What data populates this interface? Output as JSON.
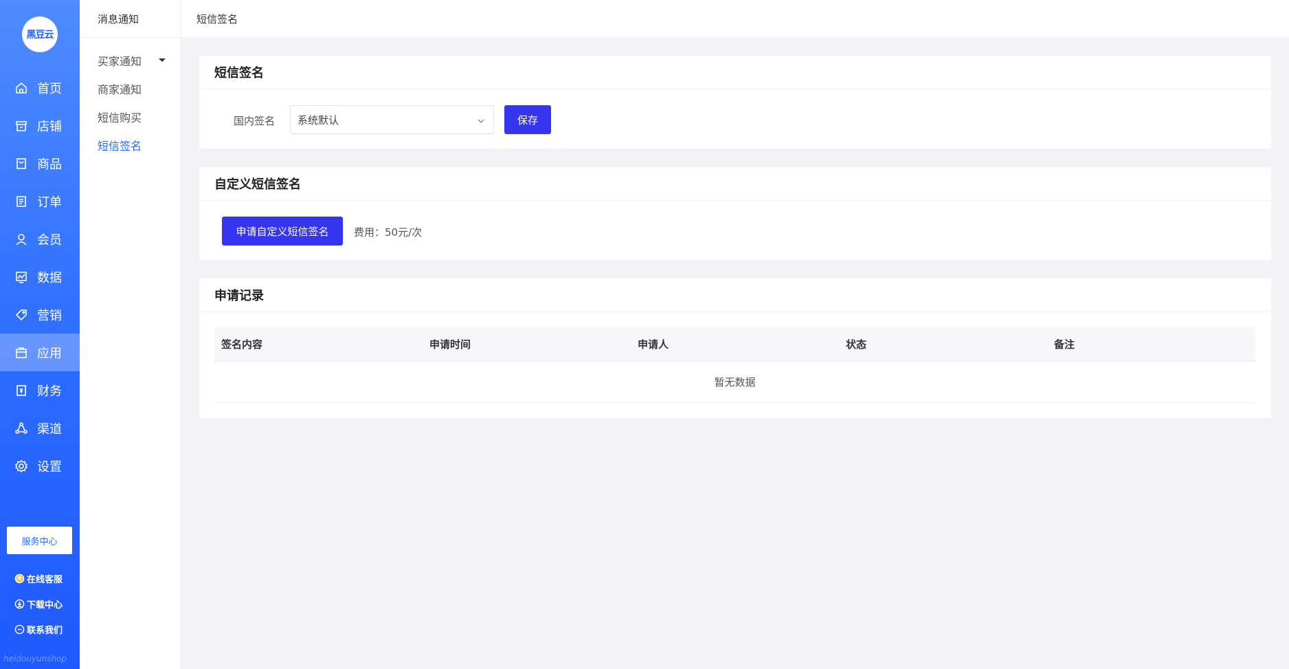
{
  "brand": {
    "logo_text": "黑豆云",
    "watermark": "heidouyunshop"
  },
  "nav": {
    "items": [
      {
        "label": "首页",
        "icon": "home-icon"
      },
      {
        "label": "店铺",
        "icon": "store-icon"
      },
      {
        "label": "商品",
        "icon": "goods-icon"
      },
      {
        "label": "订单",
        "icon": "order-icon"
      },
      {
        "label": "会员",
        "icon": "member-icon"
      },
      {
        "label": "数据",
        "icon": "data-icon"
      },
      {
        "label": "营销",
        "icon": "tag-icon"
      },
      {
        "label": "应用",
        "icon": "app-icon"
      },
      {
        "label": "财务",
        "icon": "finance-icon"
      },
      {
        "label": "渠道",
        "icon": "channel-icon"
      },
      {
        "label": "设置",
        "icon": "gear-icon"
      }
    ],
    "active": "应用"
  },
  "service": {
    "button_label": "服务中心",
    "links": [
      {
        "label": "在线客服",
        "icon": "support-avatar-icon"
      },
      {
        "label": "下载中心",
        "icon": "download-icon"
      },
      {
        "label": "联系我们",
        "icon": "contact-icon"
      }
    ]
  },
  "subside": {
    "title": "消息通知",
    "items": [
      {
        "label": "买家通知",
        "has_caret": true
      },
      {
        "label": "商家通知"
      },
      {
        "label": "短信购买"
      },
      {
        "label": "短信签名",
        "active": true
      }
    ]
  },
  "topbar": {
    "breadcrumb": "短信签名"
  },
  "signature": {
    "title": "短信签名",
    "domestic_label": "国内签名",
    "selected_value": "系统默认",
    "save_label": "保存"
  },
  "custom": {
    "title": "自定义短信签名",
    "apply_label": "申请自定义短信签名",
    "fee_text": "费用：50元/次"
  },
  "records": {
    "title": "申请记录",
    "columns": [
      "签名内容",
      "申请时间",
      "申请人",
      "状态",
      "备注"
    ],
    "empty_text": "暂无数据"
  },
  "colors": {
    "primary": "#3535ef",
    "accent_blue": "#2f6cf3",
    "rail_top": "#4d8cff",
    "rail_bottom": "#1f5aff"
  }
}
